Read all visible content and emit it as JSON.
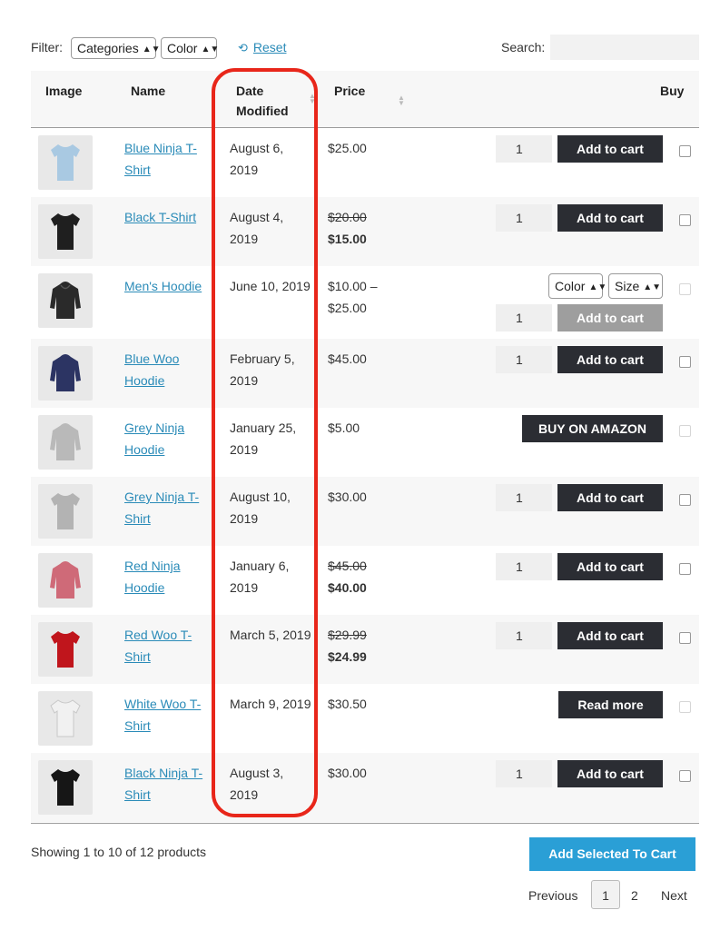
{
  "filter": {
    "label": "Filter:",
    "categories_value": "Categories",
    "color_value": "Color",
    "reset_label": "Reset",
    "search_label": "Search:",
    "search_value": ""
  },
  "table": {
    "headers": {
      "image": "Image",
      "name": "Name",
      "date_line1": "Date",
      "date_line2": "Modified",
      "price": "Price",
      "buy": "Buy"
    },
    "rows": [
      {
        "name_l1": "Blue Ninja T-",
        "name_l2": "Shirt",
        "date_l1": "August 6,",
        "date_l2": "2019",
        "price_old": "",
        "price": "$25.00",
        "price_l2": "",
        "qty": "1",
        "button": "Add to cart",
        "shirt_color": "#a9c9e2",
        "product_type": "tshirt"
      },
      {
        "name_l1": "Black T-Shirt",
        "name_l2": "",
        "date_l1": "August 4,",
        "date_l2": "2019",
        "price_old": "$20.00",
        "price": "",
        "price_l2": "$15.00",
        "qty": "1",
        "button": "Add to cart",
        "shirt_color": "#1f1f1f",
        "product_type": "tshirt"
      },
      {
        "name_l1": "Men's Hoodie",
        "name_l2": "",
        "date_l1": "June 10, 2019",
        "date_l2": "",
        "price_old": "",
        "price": "$10.00 –",
        "price_l2": "$25.00",
        "qty": "1",
        "button": "Add to cart",
        "color_select": "Color",
        "size_select": "Size",
        "shirt_color": "#2a2a2a",
        "product_type": "hoodie"
      },
      {
        "name_l1": "Blue Woo",
        "name_l2": "Hoodie",
        "date_l1": "February 5,",
        "date_l2": "2019",
        "price_old": "",
        "price": "$45.00",
        "price_l2": "",
        "qty": "1",
        "button": "Add to cart",
        "shirt_color": "#2c3463",
        "product_type": "hoodie"
      },
      {
        "name_l1": "Grey Ninja",
        "name_l2": "Hoodie",
        "date_l1": "January 25,",
        "date_l2": "2019",
        "price_old": "",
        "price": "$5.00",
        "price_l2": "",
        "qty": "",
        "button": "BUY ON AMAZON",
        "shirt_color": "#b9b9b9",
        "product_type": "hoodie"
      },
      {
        "name_l1": "Grey Ninja T-",
        "name_l2": "Shirt",
        "date_l1": "August 10,",
        "date_l2": "2019",
        "price_old": "",
        "price": "$30.00",
        "price_l2": "",
        "qty": "1",
        "button": "Add to cart",
        "shirt_color": "#b3b3b3",
        "product_type": "tshirt"
      },
      {
        "name_l1": "Red Ninja",
        "name_l2": "Hoodie",
        "date_l1": "January 6,",
        "date_l2": "2019",
        "price_old": "$45.00",
        "price": "",
        "price_l2": "$40.00",
        "qty": "1",
        "button": "Add to cart",
        "shirt_color": "#cf6a78",
        "product_type": "hoodie"
      },
      {
        "name_l1": "Red Woo T-",
        "name_l2": "Shirt",
        "date_l1": "March 5, 2019",
        "date_l2": "",
        "price_old": "$29.99",
        "price": "",
        "price_l2": "$24.99",
        "qty": "1",
        "button": "Add to cart",
        "shirt_color": "#c0151c",
        "product_type": "tshirt"
      },
      {
        "name_l1": "White Woo T-",
        "name_l2": "Shirt",
        "date_l1": "March 9, 2019",
        "date_l2": "",
        "price_old": "",
        "price": "$30.50",
        "price_l2": "",
        "qty": "",
        "button": "Read more",
        "shirt_color": "#f1f1f1",
        "product_type": "tshirt"
      },
      {
        "name_l1": "Black Ninja T-",
        "name_l2": "Shirt",
        "date_l1": "August 3,",
        "date_l2": "2019",
        "price_old": "",
        "price": "$30.00",
        "price_l2": "",
        "qty": "1",
        "button": "Add to cart",
        "shirt_color": "#161616",
        "product_type": "tshirt"
      }
    ]
  },
  "footer": {
    "showing": "Showing 1 to 10 of 12 products",
    "add_selected": "Add Selected To Cart",
    "prev": "Previous",
    "page1": "1",
    "page2": "2",
    "next": "Next"
  },
  "colors": {
    "link": "#2a8bb8",
    "button_dark": "#2b2d33",
    "accent_blue": "#2a9fd6",
    "highlight_red": "#e8261a"
  }
}
